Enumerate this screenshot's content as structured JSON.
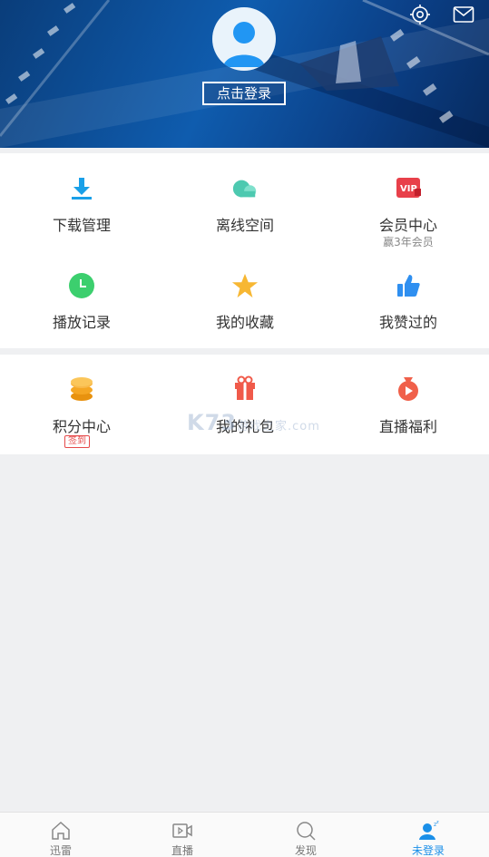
{
  "header": {
    "login_label": "点击登录",
    "icons": [
      "settings-icon",
      "mail-icon"
    ]
  },
  "grid": {
    "items": [
      {
        "label": "下载管理",
        "icon": "download-icon",
        "color": "#1aa0e8"
      },
      {
        "label": "离线空间",
        "icon": "cloud-icon",
        "color": "#4dc9b0"
      },
      {
        "label": "会员中心",
        "icon": "vip-icon",
        "color": "#e8404a",
        "sub": "赢3年会员"
      },
      {
        "label": "播放记录",
        "icon": "clock-icon",
        "color": "#3ccf6e"
      },
      {
        "label": "我的收藏",
        "icon": "star-icon",
        "color": "#f7b733"
      },
      {
        "label": "我赞过的",
        "icon": "thumbs-up-icon",
        "color": "#2f8ff0"
      }
    ]
  },
  "grid2": {
    "items": [
      {
        "label": "积分中心",
        "icon": "coins-icon",
        "color": "#f5a623",
        "badge": "签到"
      },
      {
        "label": "我的礼包",
        "icon": "gift-icon",
        "color": "#f05a4a"
      },
      {
        "label": "直播福利",
        "icon": "play-bag-icon",
        "color": "#f0604a"
      }
    ]
  },
  "watermark": {
    "text": "K73",
    "suffix": "游戏之家",
    "domain": ".com"
  },
  "nav": {
    "items": [
      {
        "label": "迅雷",
        "icon": "home-icon"
      },
      {
        "label": "直播",
        "icon": "video-icon"
      },
      {
        "label": "发现",
        "icon": "search-icon"
      },
      {
        "label": "未登录",
        "icon": "user-icon",
        "active": true
      }
    ]
  }
}
